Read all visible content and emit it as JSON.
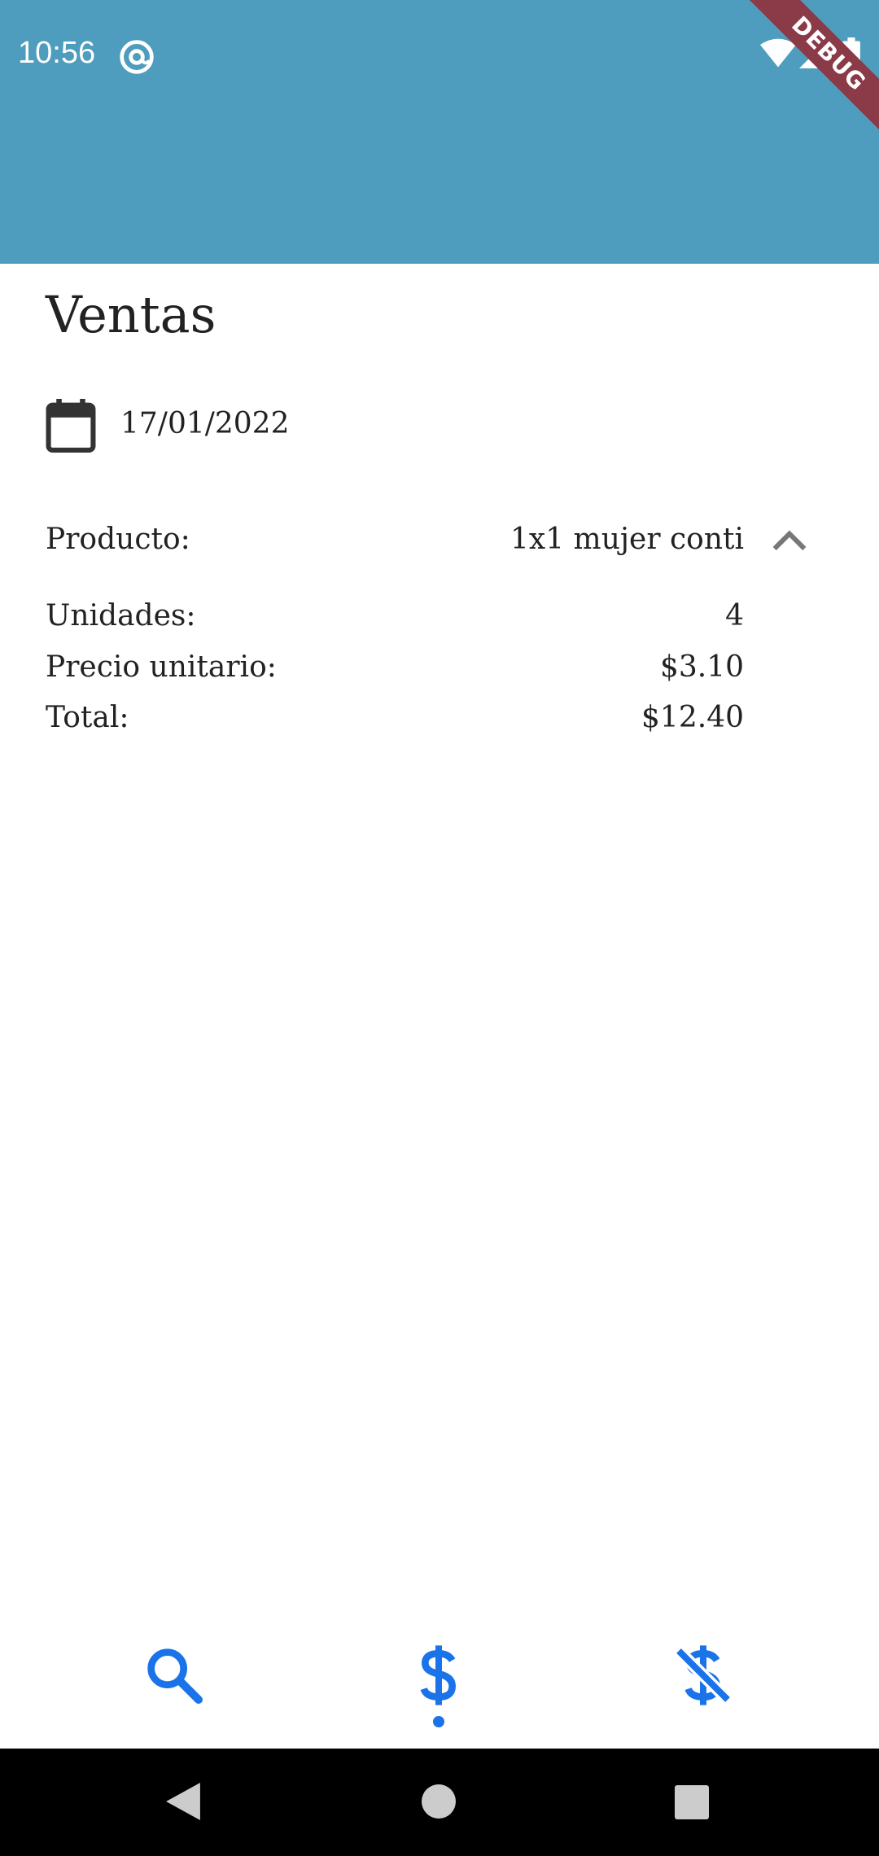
{
  "status_bar": {
    "time": "10:56",
    "icons": [
      "at-sign-icon",
      "wifi-icon",
      "signal-icon",
      "battery-icon"
    ],
    "debug_label": "DEBUG"
  },
  "page": {
    "title": "Ventas",
    "date": "17/01/2022"
  },
  "form": {
    "product_label": "Producto:",
    "product_value": "1x1 mujer conti",
    "units_label": "Unidades:",
    "units_value": "4",
    "unit_price_label": "Precio unitario:",
    "unit_price_value": "$3.10",
    "total_label": "Total:",
    "total_value": "$12.40"
  },
  "bottom_nav": {
    "items": [
      "search-icon",
      "dollar-icon",
      "money-off-icon"
    ],
    "active_index": 1
  },
  "colors": {
    "appbar": "#4e9dbe",
    "accent": "#1a73e8",
    "debug_banner": "#8b3a47"
  }
}
